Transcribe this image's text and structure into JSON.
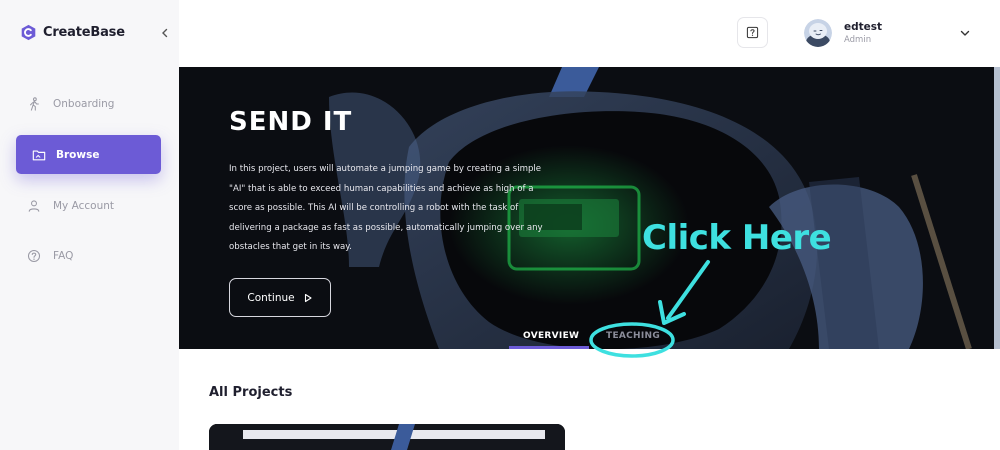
{
  "brand": {
    "name": "CreateBase"
  },
  "sidebar": {
    "items": [
      {
        "label": "Onboarding",
        "icon": "walking-person-icon"
      },
      {
        "label": "Browse",
        "icon": "folder-icon"
      },
      {
        "label": "My Account",
        "icon": "user-icon"
      },
      {
        "label": "FAQ",
        "icon": "help-circle-icon"
      }
    ],
    "active": "Browse"
  },
  "user": {
    "name": "edtest",
    "role": "Admin"
  },
  "hero": {
    "title": "SEND IT",
    "description": "In this project, users will automate a jumping game by creating a simple \"AI\" that is able to exceed human capabilities and achieve as high of a score as possible. This AI will be controlling a robot with the task of delivering a package as fast as possible, automatically jumping over any obstacles that get in its way.",
    "continue_label": "Continue",
    "tabs": [
      {
        "label": "OVERVIEW"
      },
      {
        "label": "TEACHING"
      }
    ],
    "active_tab": "OVERVIEW"
  },
  "annotation": {
    "text": "Click Here"
  },
  "projects": {
    "title": "All Projects"
  },
  "colors": {
    "accent": "#6c5bd6",
    "annotation": "#3ee0e0"
  }
}
